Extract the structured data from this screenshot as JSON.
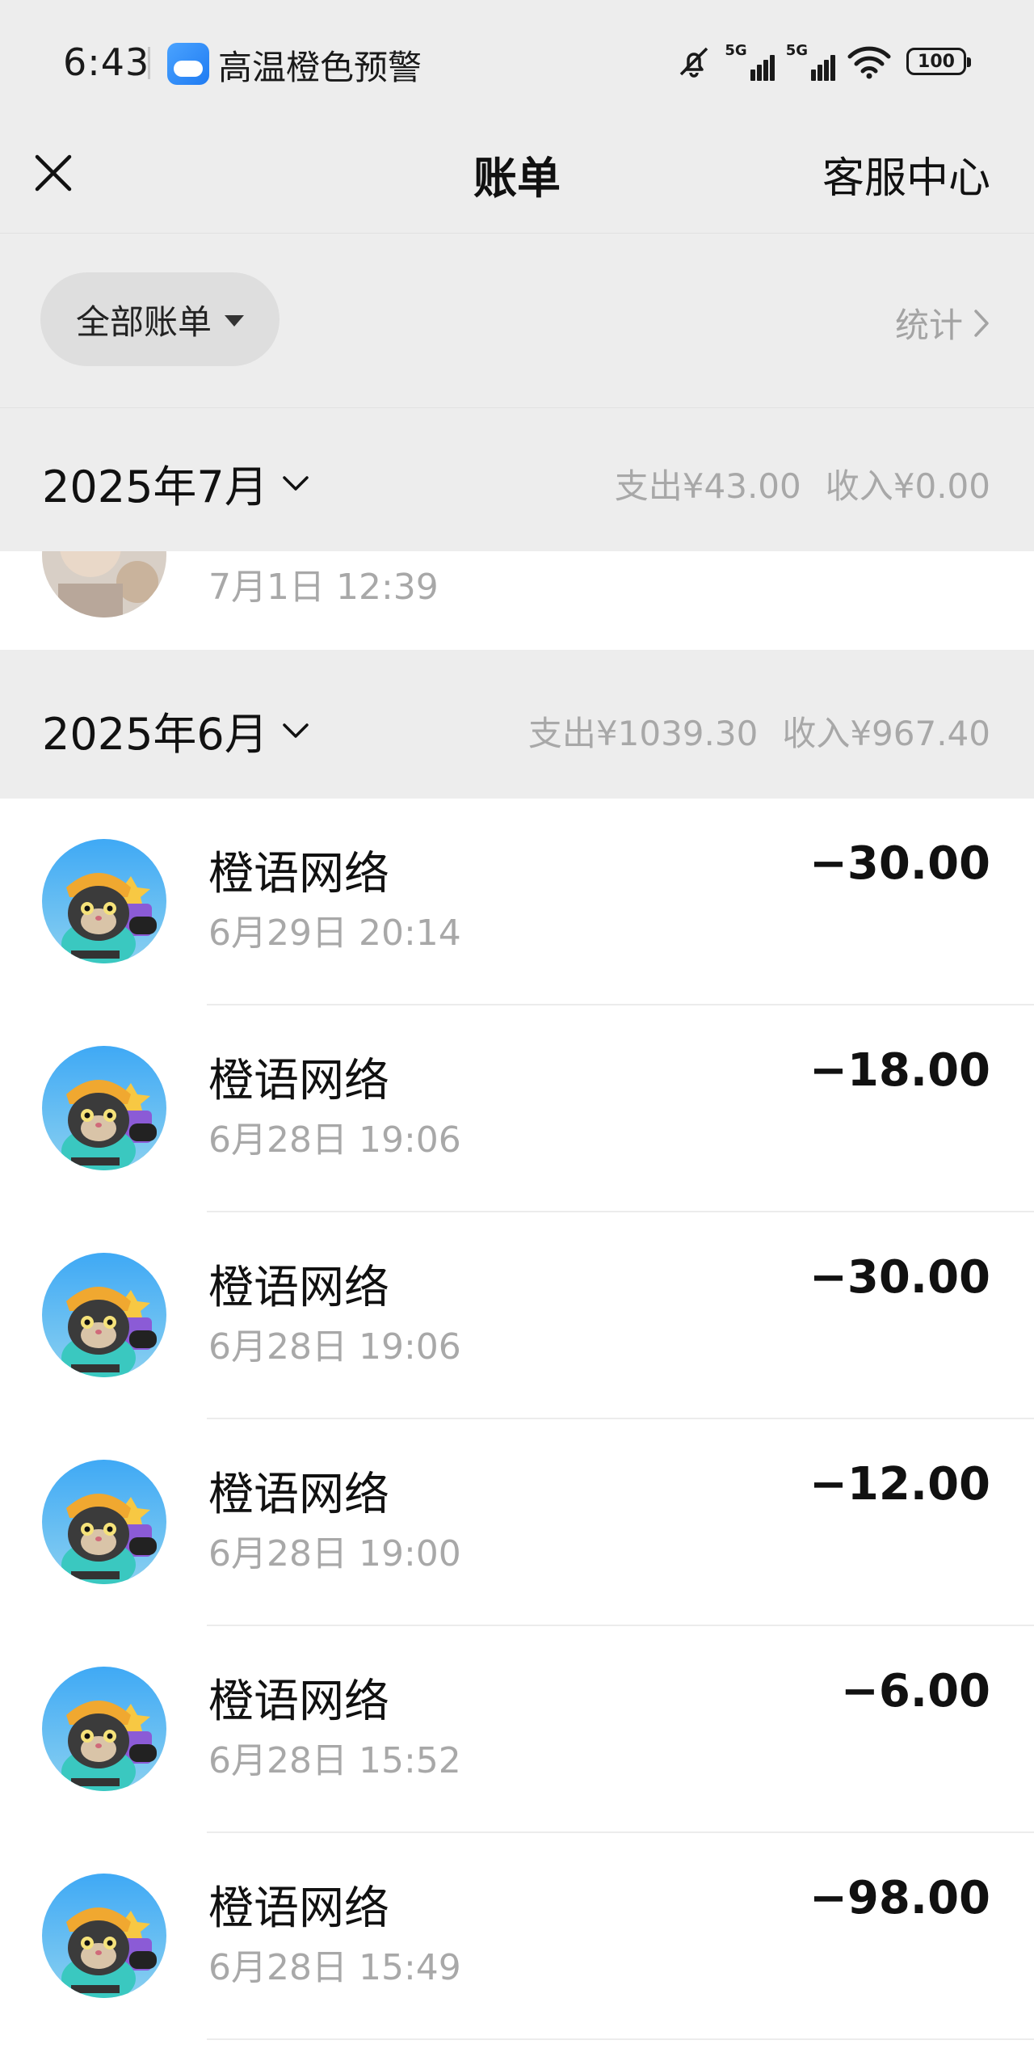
{
  "status_bar": {
    "time": "6:43",
    "alert": "高温橙色预警",
    "network_1": "5G",
    "network_2": "5G",
    "battery": "100"
  },
  "nav": {
    "title": "账单",
    "service": "客服中心"
  },
  "filter": {
    "label": "全部账单",
    "stats": "统计"
  },
  "months": [
    {
      "title": "2025年7月",
      "expense": "支出¥43.00",
      "income": "收入¥0.00",
      "rows": [
        {
          "time": "7月1日 12:39"
        }
      ]
    },
    {
      "title": "2025年6月",
      "expense": "支出¥1039.30",
      "income": "收入¥967.40",
      "rows": [
        {
          "merchant": "橙语网络",
          "time": "6月29日 20:14",
          "amount": "−30.00"
        },
        {
          "merchant": "橙语网络",
          "time": "6月28日 19:06",
          "amount": "−18.00"
        },
        {
          "merchant": "橙语网络",
          "time": "6月28日 19:06",
          "amount": "−30.00"
        },
        {
          "merchant": "橙语网络",
          "time": "6月28日 19:00",
          "amount": "−12.00"
        },
        {
          "merchant": "橙语网络",
          "time": "6月28日 15:52",
          "amount": "−6.00"
        },
        {
          "merchant": "橙语网络",
          "time": "6月28日 15:49",
          "amount": "−98.00"
        }
      ]
    }
  ],
  "colors": {
    "background": "#ededed",
    "list_background": "#ffffff",
    "secondary_text": "#a8a8a8",
    "primary_text": "#111111"
  }
}
